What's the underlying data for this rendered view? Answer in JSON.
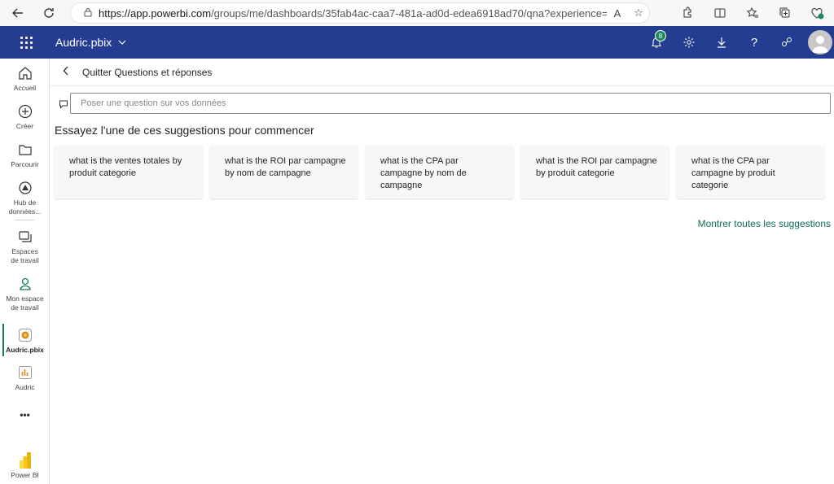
{
  "browser": {
    "url_host": "https://app.powerbi.com",
    "url_path": "/groups/me/dashboards/35fab4ac-caa7-481a-ad0d-edea6918ad70/qna?experience=pow..."
  },
  "header": {
    "app_title": "Audric.pbix",
    "notification_count": "8",
    "help_glyph": "?"
  },
  "nav": {
    "items": [
      {
        "label": "Accueil",
        "icon": "home-icon"
      },
      {
        "label": "Créer",
        "icon": "plus-circle-icon"
      },
      {
        "label": "Parcourir",
        "icon": "folder-icon"
      },
      {
        "label": "Hub de données...",
        "icon": "data-hub-icon"
      },
      {
        "label": "Espaces de travail",
        "icon": "workspaces-icon"
      },
      {
        "label": "Mon espace de travail",
        "icon": "person-icon"
      },
      {
        "label": "Audric.pbix",
        "icon": "pbix-icon"
      },
      {
        "label": "Audric",
        "icon": "report-icon"
      }
    ],
    "more": "•••",
    "brand": "Power BI"
  },
  "topbar": {
    "quit_label": "Quitter Questions et réponses"
  },
  "qa": {
    "placeholder": "Poser une question sur vos données"
  },
  "suggestions": {
    "title": "Essayez l'une de ces suggestions pour commencer",
    "items": [
      "what is the ventes totales by produit categorie",
      "what is the ROI par campagne by nom de campagne",
      "what is the CPA par campagne by nom de campagne",
      "what is the ROI par campagne by produit categorie",
      "what is the CPA par campagne by produit categorie"
    ],
    "show_all": "Montrer toutes les suggestions"
  },
  "colors": {
    "header_bg": "#253d90",
    "accent": "#117865",
    "link": "#0f6c5a"
  }
}
